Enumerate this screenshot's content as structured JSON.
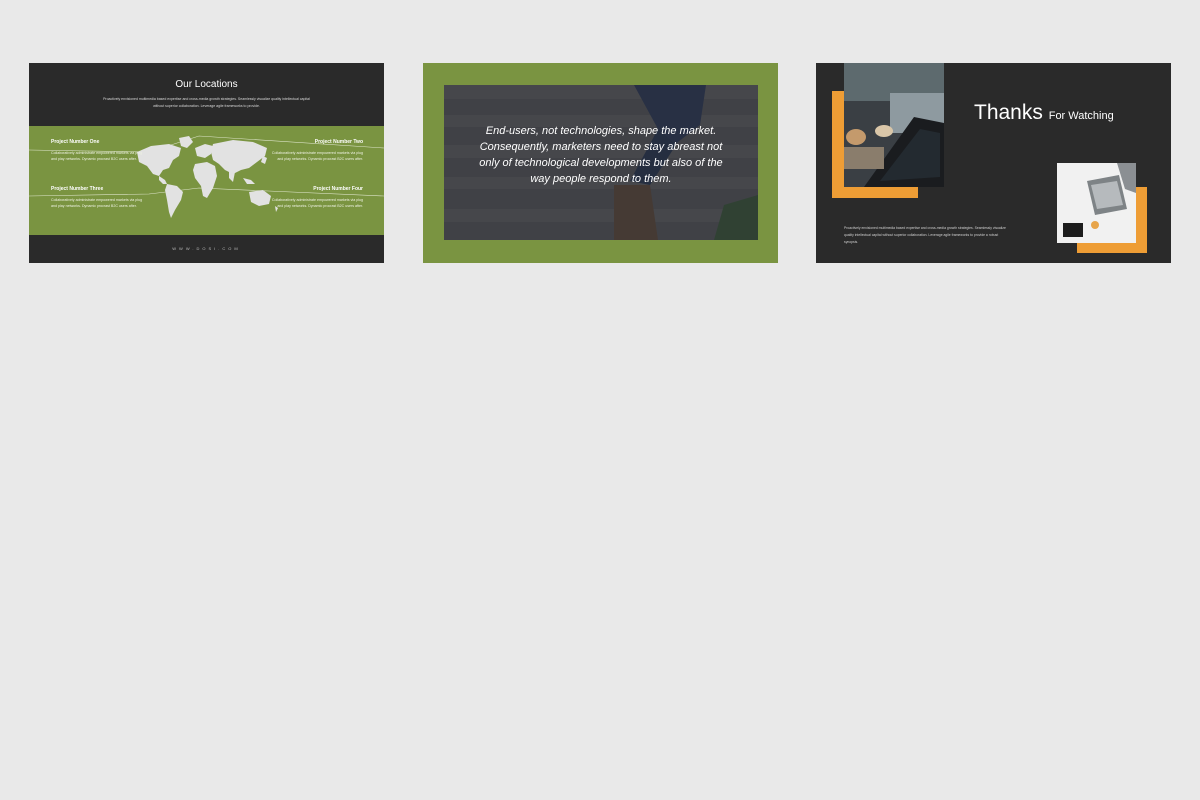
{
  "slide1": {
    "title": "Our Locations",
    "subtitle": "Proactively envisioned multimedia based expertise and cross-media growth strategies. Seamlessly visualize quality intellectual capital without superior collaboration. Leverage agile frameworks to provide.",
    "projects": [
      {
        "heading": "Project Number One",
        "body": "Collaboratively administrate empowered markets via plug and play networks. Dynamic procrast B2C users after."
      },
      {
        "heading": "Project Number Two",
        "body": "Collaboratively administrate empowered markets via plug and play networks. Dynamic procrast B2C users after."
      },
      {
        "heading": "Project Number Three",
        "body": "Collaboratively administrate empowered markets via plug and play networks. Dynamic procrast B2C users after."
      },
      {
        "heading": "Project Number Four",
        "body": "Collaboratively administrate empowered markets via plug and play networks. Dynamic procrast B2C users after."
      }
    ],
    "url": "WWW.DOSI.COM"
  },
  "slide2": {
    "quote": "End-users, not technologies, shape the market. Consequently, marketers need to stay abreast not only of technological developments but also of the way people respond to them."
  },
  "slide3": {
    "title_main": "Thanks",
    "title_small": "For Watching",
    "body": "Proactively envisioned multimedia based expertise and cross-media growth strategies. Seamlessly visualize quality intellectual capital without superior collaboration. Leverage agile frameworks to provide a robust synopsis."
  },
  "colors": {
    "background": "#e9e9e9",
    "dark": "#2a2a2a",
    "green": "#7a9441",
    "orange": "#ee9d35"
  }
}
